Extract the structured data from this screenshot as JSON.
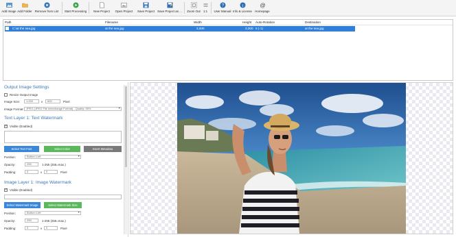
{
  "toolbar": {
    "items": [
      {
        "label": "Add Image",
        "icon": "add-image-icon"
      },
      {
        "label": "Add Folder",
        "icon": "folder-icon"
      },
      {
        "label": "Remove from List",
        "icon": "remove-icon"
      },
      {
        "label": "Start Processing",
        "icon": "play-icon"
      },
      {
        "label": "New Project",
        "icon": "new-project-icon"
      },
      {
        "label": "Open Project",
        "icon": "open-project-icon"
      },
      {
        "label": "Save Project",
        "icon": "save-icon"
      },
      {
        "label": "Save Project as ...",
        "icon": "save-as-icon"
      },
      {
        "label": "Zoom Out",
        "icon": "zoom-out-icon"
      },
      {
        "label": "1:1",
        "icon": "actual-size-icon"
      },
      {
        "label": "User Manual",
        "icon": "help-icon"
      },
      {
        "label": "Info & License",
        "icon": "info-icon"
      },
      {
        "label": "Homepage",
        "icon": "at-icon"
      }
    ]
  },
  "filelist": {
    "headers": {
      "path": "Path",
      "filename": "Filename",
      "width": "Width",
      "height": "Height",
      "rotation": "Auto-Rotation",
      "destination": "Destination"
    },
    "row": {
      "path": "C:\\at the sea.jpg",
      "filename": "at the sea.jpg",
      "width": "3,000",
      "height": "3,000",
      "rotation": "0 (-1)",
      "destination": "at the sea.jpg"
    }
  },
  "output": {
    "title": "Output Image Settings",
    "resize_label": "Resize Output Image",
    "image_size_label": "Image Size:",
    "width_value": "1,000",
    "x_label": "x",
    "height_value": "600",
    "unit": "Pixel",
    "format_label": "Image Format:",
    "format_value": "JPEG (JPEG File Interchange Format) - Quality: 90%"
  },
  "text_layer": {
    "title": "Text Layer 1: Text Watermark",
    "visible_label": "Visible (Enabled)",
    "select_font": "Select Text Font",
    "select_color": "Select Color",
    "insert_metadata": "Insert Metadata",
    "position_label": "Position:",
    "position_value": "Bottom Left",
    "opacity_label": "Opacity:",
    "opacity_value": "255",
    "opacity_range": "1-255 (255=max.)",
    "padding_label": "Padding:",
    "padding_x": "0",
    "padding_sep": "x",
    "padding_y": "0",
    "padding_unit": "Pixel"
  },
  "image_layer": {
    "title": "Image Layer 1: Image Watermark",
    "visible_label": "Visible (Enabled)",
    "select_image": "Select Watermark Image",
    "select_size": "Select Watermark Size",
    "position_label": "Position:",
    "position_value": "Bottom Left",
    "opacity_label": "Opacity:",
    "opacity_value": "255",
    "opacity_range": "1-255 (255=max.)",
    "padding_label": "Padding:",
    "padding_x": "0",
    "padding_sep": "x",
    "padding_y": "0",
    "padding_unit": "Pixel"
  },
  "colors": {
    "accent_blue": "#3a87d9",
    "accent_green": "#5cb85c",
    "section_title": "#3f78b5",
    "selection": "#2f7ed8"
  }
}
